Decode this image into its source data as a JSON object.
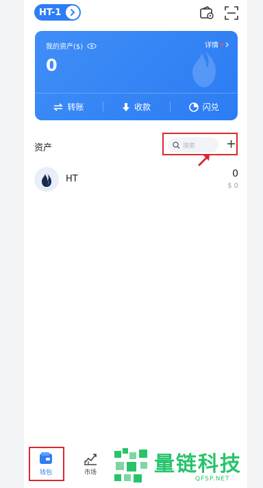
{
  "header": {
    "chain_label": "HT-1"
  },
  "card": {
    "assets_label": "我的资产($)",
    "details_label": "详情",
    "total": "0",
    "actions": [
      {
        "label": "转账",
        "icon": "transfer-icon"
      },
      {
        "label": "收款",
        "icon": "receive-icon"
      },
      {
        "label": "闪兑",
        "icon": "swap-icon"
      }
    ]
  },
  "assets": {
    "title": "资产",
    "search_placeholder": "搜索",
    "add_symbol": "+",
    "list": [
      {
        "symbol": "HT",
        "balance": "0",
        "fiat": "$ 0"
      }
    ]
  },
  "nav": {
    "wallet_label": "钱包",
    "market_label": "市场"
  },
  "watermark": {
    "brand": "量链科技",
    "domain": "QFSP.NET"
  },
  "colors": {
    "accent": "#2f7df6",
    "highlight_box": "#d9282f",
    "watermark": "#27c46c"
  }
}
